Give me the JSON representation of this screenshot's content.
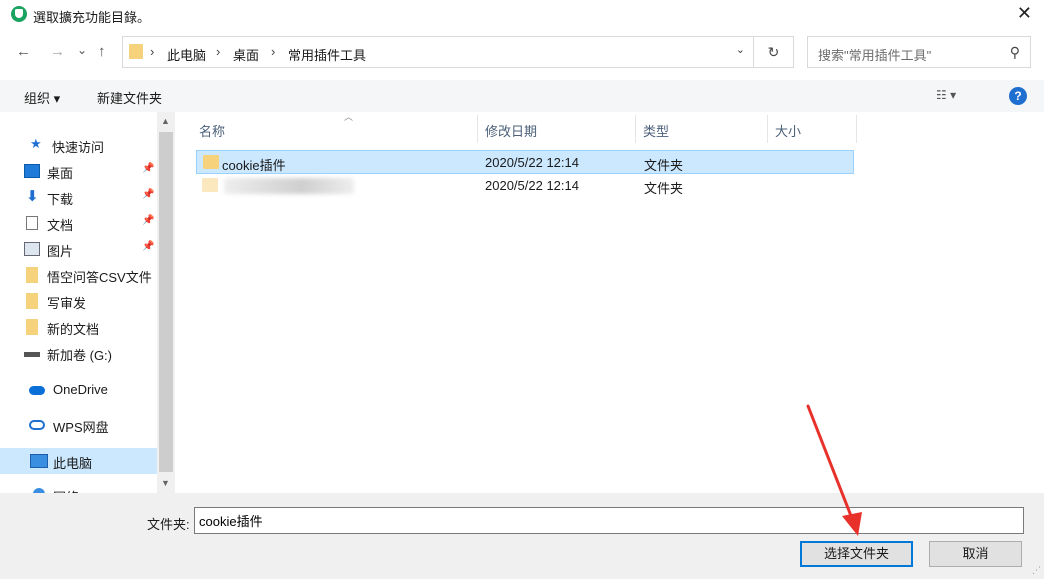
{
  "window": {
    "title": "選取擴充功能目錄。",
    "close": "✕"
  },
  "nav": {
    "back": "←",
    "forward": "→",
    "recent": "⌄",
    "up": "↑",
    "breadcrumbs": [
      "此电脑",
      "桌面",
      "常用插件工具"
    ],
    "separator": "›",
    "address_dropdown": "⌄",
    "refresh": "↻",
    "search_placeholder": "搜索\"常用插件工具\"",
    "search_icon": "⚲"
  },
  "toolbar": {
    "organize": "组织 ▾",
    "new_folder": "新建文件夹",
    "view_icon": "☷ ▾",
    "help": "?"
  },
  "sidebar": {
    "items": [
      {
        "label": "快速访问",
        "icon": "star-icon",
        "pinned": false
      },
      {
        "label": "桌面",
        "icon": "desktop-icon",
        "pinned": true
      },
      {
        "label": "下载",
        "icon": "download-icon",
        "pinned": true
      },
      {
        "label": "文档",
        "icon": "document-icon",
        "pinned": true
      },
      {
        "label": "图片",
        "icon": "picture-icon",
        "pinned": true
      },
      {
        "label": "悟空问答CSV文件",
        "icon": "folder-icon",
        "pinned": false
      },
      {
        "label": "写审发",
        "icon": "folder-icon",
        "pinned": false
      },
      {
        "label": "新的文档",
        "icon": "folder-icon",
        "pinned": false
      },
      {
        "label": "新加卷 (G:)",
        "icon": "drive-icon",
        "pinned": false
      },
      {
        "label": "OneDrive",
        "icon": "cloud-icon",
        "pinned": false
      },
      {
        "label": "WPS网盘",
        "icon": "cloud-outline-icon",
        "pinned": false
      },
      {
        "label": "此电脑",
        "icon": "computer-icon",
        "pinned": false,
        "selected": true
      },
      {
        "label": "网络",
        "icon": "network-icon",
        "pinned": false
      }
    ],
    "pin_glyph": "📌"
  },
  "columns": [
    "名称",
    "修改日期",
    "类型",
    "大小"
  ],
  "files": [
    {
      "name": "cookie插件",
      "modified": "2020/5/22 12:14",
      "type": "文件夹",
      "size": "",
      "selected": true
    },
    {
      "name": "",
      "modified": "2020/5/22 12:14",
      "type": "文件夹",
      "size": "",
      "selected": false,
      "obscured": true
    }
  ],
  "footer": {
    "folder_label": "文件夹:",
    "folder_value": "cookie插件",
    "select_button": "选择文件夹",
    "cancel_button": "取消"
  },
  "colors": {
    "selection": "#cce8ff",
    "accent": "#0078d7",
    "annotation_arrow": "#e8312a"
  }
}
